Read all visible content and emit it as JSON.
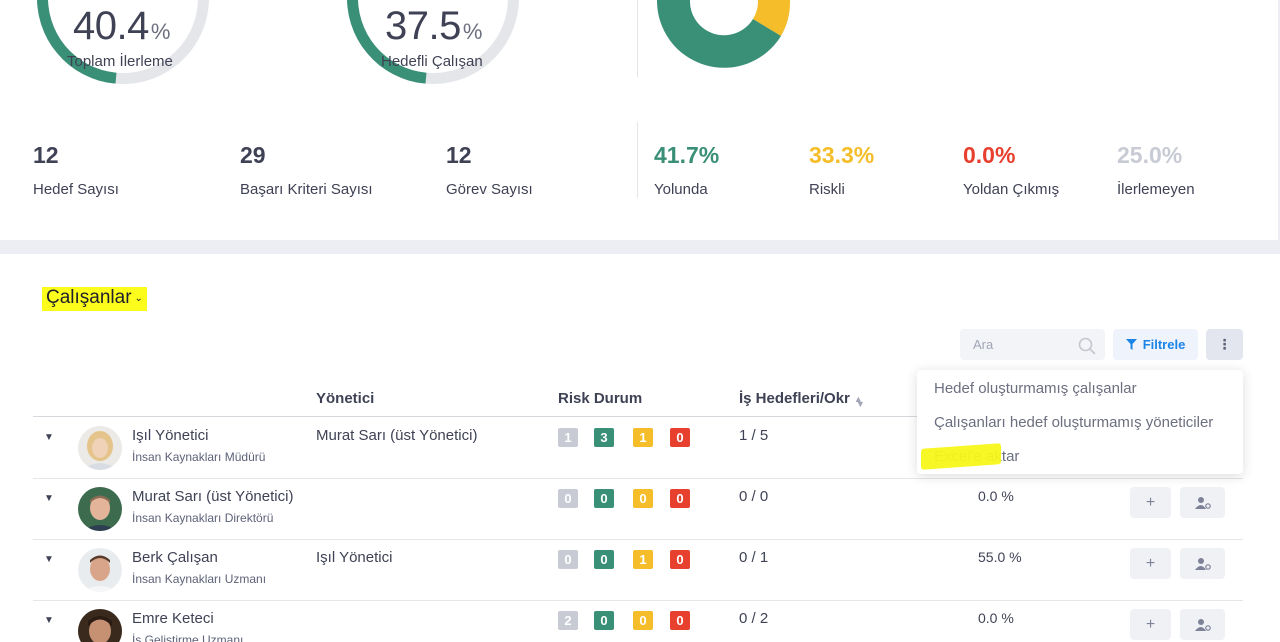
{
  "summary": {
    "gauges": [
      {
        "value": "40.4",
        "unit": "%",
        "label": "Toplam İlerleme"
      },
      {
        "value": "37.5",
        "unit": "%",
        "label": "Hedefli Çalışan"
      }
    ],
    "donut_colors": {
      "green": "#3a8f77",
      "yellow": "#f5bd29",
      "gray": "#c8cbd4"
    },
    "counts": [
      {
        "value": "12",
        "label": "Hedef Sayısı"
      },
      {
        "value": "29",
        "label": "Başarı Kriteri Sayısı"
      },
      {
        "value": "12",
        "label": "Görev Sayısı"
      }
    ],
    "statuses": [
      {
        "value": "41.7%",
        "label": "Yolunda",
        "color": "#3a8f77"
      },
      {
        "value": "33.3%",
        "label": "Riskli",
        "color": "#f5bd29"
      },
      {
        "value": "0.0%",
        "label": "Yoldan Çıkmış",
        "color": "#e8402f"
      },
      {
        "value": "25.0%",
        "label": "İlerlemeyen",
        "color": "#c8cbd4"
      }
    ]
  },
  "employees": {
    "title": "Çalışanlar",
    "search_placeholder": "Ara",
    "filter_label": "Filtrele",
    "columns": {
      "manager": "Yönetici",
      "risk": "Risk Durum",
      "goals": "İş Hedefleri/Okr"
    },
    "dropdown": [
      "Hedef oluşturmamış çalışanlar",
      "Çalışanları hedef oluşturmamış yöneticiler",
      "Excel'e aktar"
    ],
    "rows": [
      {
        "name": "Işıl Yönetici",
        "title": "İnsan Kaynakları Müdürü",
        "manager": "Murat Sarı (üst Yönetici)",
        "risk": [
          "1",
          "3",
          "1",
          "0"
        ],
        "goals": "1 / 5",
        "progress": ""
      },
      {
        "name": "Murat Sarı (üst Yönetici)",
        "title": "İnsan Kaynakları Direktörü",
        "manager": "",
        "risk": [
          "0",
          "0",
          "0",
          "0"
        ],
        "goals": "0 / 0",
        "progress": "0.0 %"
      },
      {
        "name": "Berk Çalışan",
        "title": "İnsan Kaynakları Uzmanı",
        "manager": "Işıl Yönetici",
        "risk": [
          "0",
          "0",
          "1",
          "0"
        ],
        "goals": "0 / 1",
        "progress": "55.0 %"
      },
      {
        "name": "Emre Keteci",
        "title": "İş Geliştirme Uzmanı",
        "manager": "",
        "risk": [
          "2",
          "0",
          "0",
          "0"
        ],
        "goals": "0 / 2",
        "progress": "0.0 %"
      }
    ]
  }
}
